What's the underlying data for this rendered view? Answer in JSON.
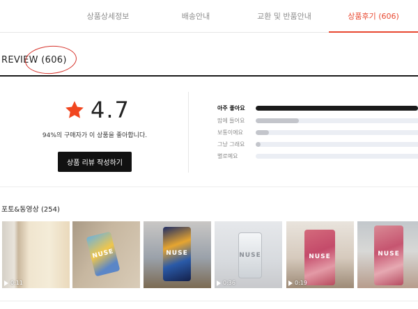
{
  "tabs": [
    {
      "label": "상품상세정보"
    },
    {
      "label": "배송안내"
    },
    {
      "label": "교환 및 반품안내"
    },
    {
      "label": "상품후기 (606)"
    }
  ],
  "review": {
    "title": "REVIEW (606)",
    "rating_value": "4.7",
    "satisfaction_text": "94%의 구매자가 이 상품을 좋아합니다.",
    "write_button_label": "상품 리뷰 작성하기"
  },
  "rating_breakdown": [
    {
      "label": "아주 좋아요",
      "fraction": 0.97
    },
    {
      "label": "맘에 들어요",
      "fraction": 0.26
    },
    {
      "label": "보통이에요",
      "fraction": 0.08
    },
    {
      "label": "그냥 그래요",
      "fraction": 0.03
    },
    {
      "label": "별로예요",
      "fraction": 0.0
    }
  ],
  "photos": {
    "title": "포토&동영상 (254)",
    "items": [
      {
        "duration": "0:11",
        "brand": ""
      },
      {
        "duration": "",
        "brand": "NUSE"
      },
      {
        "duration": "",
        "brand": "NUSE"
      },
      {
        "duration": "0:36",
        "brand": "NUSE"
      },
      {
        "duration": "0:19",
        "brand": "NUSE"
      },
      {
        "duration": "",
        "brand": "NUSE"
      }
    ]
  },
  "colors": {
    "accent": "#e8472f",
    "star": "#f1461f",
    "primary_button": "#111111",
    "bar_top": "#1a1a1a",
    "bar_other": "#c3c5cb",
    "bar_track": "#ebeef4",
    "annotation": "#d6322a"
  },
  "icons": {
    "star": "star-icon",
    "play": "play-icon"
  }
}
